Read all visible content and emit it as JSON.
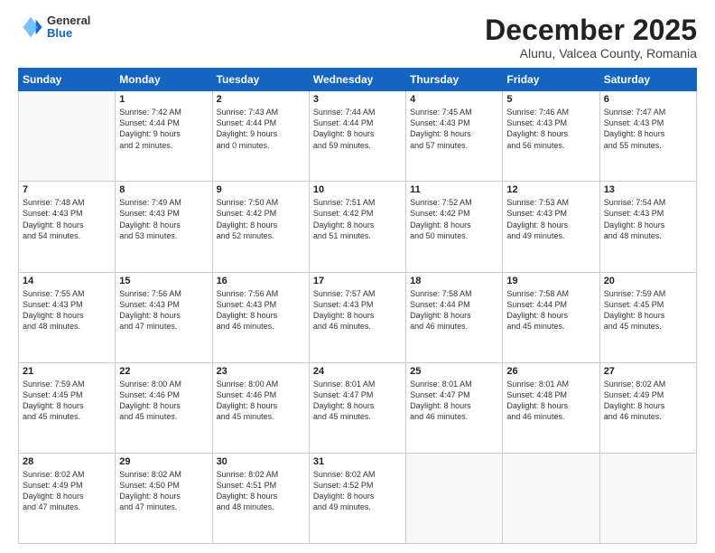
{
  "header": {
    "logo_general": "General",
    "logo_blue": "Blue",
    "month": "December 2025",
    "location": "Alunu, Valcea County, Romania"
  },
  "days_of_week": [
    "Sunday",
    "Monday",
    "Tuesday",
    "Wednesday",
    "Thursday",
    "Friday",
    "Saturday"
  ],
  "weeks": [
    [
      {
        "day": "",
        "info": ""
      },
      {
        "day": "1",
        "info": "Sunrise: 7:42 AM\nSunset: 4:44 PM\nDaylight: 9 hours\nand 2 minutes."
      },
      {
        "day": "2",
        "info": "Sunrise: 7:43 AM\nSunset: 4:44 PM\nDaylight: 9 hours\nand 0 minutes."
      },
      {
        "day": "3",
        "info": "Sunrise: 7:44 AM\nSunset: 4:44 PM\nDaylight: 8 hours\nand 59 minutes."
      },
      {
        "day": "4",
        "info": "Sunrise: 7:45 AM\nSunset: 4:43 PM\nDaylight: 8 hours\nand 57 minutes."
      },
      {
        "day": "5",
        "info": "Sunrise: 7:46 AM\nSunset: 4:43 PM\nDaylight: 8 hours\nand 56 minutes."
      },
      {
        "day": "6",
        "info": "Sunrise: 7:47 AM\nSunset: 4:43 PM\nDaylight: 8 hours\nand 55 minutes."
      }
    ],
    [
      {
        "day": "7",
        "info": "Sunrise: 7:48 AM\nSunset: 4:43 PM\nDaylight: 8 hours\nand 54 minutes."
      },
      {
        "day": "8",
        "info": "Sunrise: 7:49 AM\nSunset: 4:43 PM\nDaylight: 8 hours\nand 53 minutes."
      },
      {
        "day": "9",
        "info": "Sunrise: 7:50 AM\nSunset: 4:42 PM\nDaylight: 8 hours\nand 52 minutes."
      },
      {
        "day": "10",
        "info": "Sunrise: 7:51 AM\nSunset: 4:42 PM\nDaylight: 8 hours\nand 51 minutes."
      },
      {
        "day": "11",
        "info": "Sunrise: 7:52 AM\nSunset: 4:42 PM\nDaylight: 8 hours\nand 50 minutes."
      },
      {
        "day": "12",
        "info": "Sunrise: 7:53 AM\nSunset: 4:43 PM\nDaylight: 8 hours\nand 49 minutes."
      },
      {
        "day": "13",
        "info": "Sunrise: 7:54 AM\nSunset: 4:43 PM\nDaylight: 8 hours\nand 48 minutes."
      }
    ],
    [
      {
        "day": "14",
        "info": "Sunrise: 7:55 AM\nSunset: 4:43 PM\nDaylight: 8 hours\nand 48 minutes."
      },
      {
        "day": "15",
        "info": "Sunrise: 7:56 AM\nSunset: 4:43 PM\nDaylight: 8 hours\nand 47 minutes."
      },
      {
        "day": "16",
        "info": "Sunrise: 7:56 AM\nSunset: 4:43 PM\nDaylight: 8 hours\nand 46 minutes."
      },
      {
        "day": "17",
        "info": "Sunrise: 7:57 AM\nSunset: 4:43 PM\nDaylight: 8 hours\nand 46 minutes."
      },
      {
        "day": "18",
        "info": "Sunrise: 7:58 AM\nSunset: 4:44 PM\nDaylight: 8 hours\nand 46 minutes."
      },
      {
        "day": "19",
        "info": "Sunrise: 7:58 AM\nSunset: 4:44 PM\nDaylight: 8 hours\nand 45 minutes."
      },
      {
        "day": "20",
        "info": "Sunrise: 7:59 AM\nSunset: 4:45 PM\nDaylight: 8 hours\nand 45 minutes."
      }
    ],
    [
      {
        "day": "21",
        "info": "Sunrise: 7:59 AM\nSunset: 4:45 PM\nDaylight: 8 hours\nand 45 minutes."
      },
      {
        "day": "22",
        "info": "Sunrise: 8:00 AM\nSunset: 4:46 PM\nDaylight: 8 hours\nand 45 minutes."
      },
      {
        "day": "23",
        "info": "Sunrise: 8:00 AM\nSunset: 4:46 PM\nDaylight: 8 hours\nand 45 minutes."
      },
      {
        "day": "24",
        "info": "Sunrise: 8:01 AM\nSunset: 4:47 PM\nDaylight: 8 hours\nand 45 minutes."
      },
      {
        "day": "25",
        "info": "Sunrise: 8:01 AM\nSunset: 4:47 PM\nDaylight: 8 hours\nand 46 minutes."
      },
      {
        "day": "26",
        "info": "Sunrise: 8:01 AM\nSunset: 4:48 PM\nDaylight: 8 hours\nand 46 minutes."
      },
      {
        "day": "27",
        "info": "Sunrise: 8:02 AM\nSunset: 4:49 PM\nDaylight: 8 hours\nand 46 minutes."
      }
    ],
    [
      {
        "day": "28",
        "info": "Sunrise: 8:02 AM\nSunset: 4:49 PM\nDaylight: 8 hours\nand 47 minutes."
      },
      {
        "day": "29",
        "info": "Sunrise: 8:02 AM\nSunset: 4:50 PM\nDaylight: 8 hours\nand 47 minutes."
      },
      {
        "day": "30",
        "info": "Sunrise: 8:02 AM\nSunset: 4:51 PM\nDaylight: 8 hours\nand 48 minutes."
      },
      {
        "day": "31",
        "info": "Sunrise: 8:02 AM\nSunset: 4:52 PM\nDaylight: 8 hours\nand 49 minutes."
      },
      {
        "day": "",
        "info": ""
      },
      {
        "day": "",
        "info": ""
      },
      {
        "day": "",
        "info": ""
      }
    ]
  ]
}
